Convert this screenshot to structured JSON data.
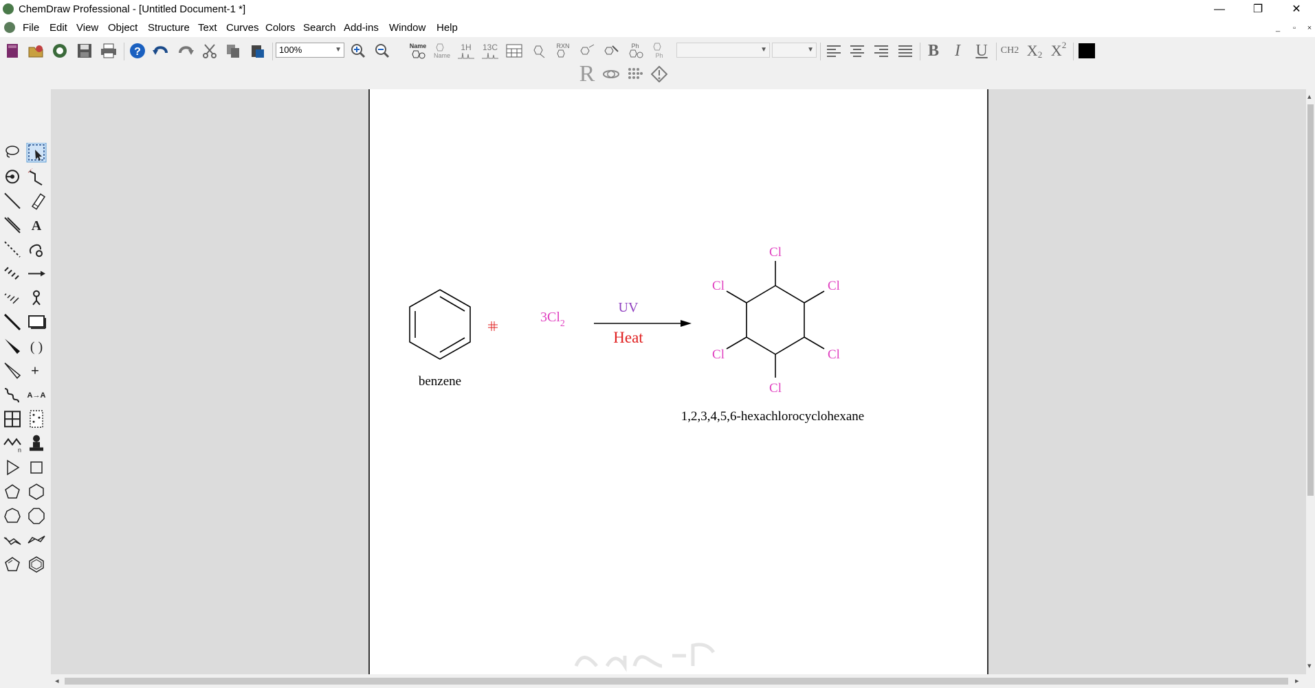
{
  "window": {
    "title": "ChemDraw Professional - [Untitled Document-1 *]",
    "app_icon": "chemdraw-icon",
    "controls": {
      "minimize": "—",
      "restore": "❐",
      "close": "✕"
    }
  },
  "menubar": {
    "items": [
      "File",
      "Edit",
      "View",
      "Object",
      "Structure",
      "Text",
      "Curves",
      "Colors",
      "Search",
      "Add-ins",
      "Window",
      "Help"
    ],
    "mdi_controls": {
      "minimize": "_",
      "restore": "▫",
      "close": "×"
    }
  },
  "toolbar": {
    "zoom": "100%",
    "name_label": "Name",
    "name_struct_label": "Name",
    "h1_label": "1H",
    "c13_label": "13C",
    "rxn_label": "RXN",
    "ph_label": "Ph",
    "r_label": "R",
    "font_value": "",
    "size_value": "",
    "bold_label": "B",
    "italic_label": "I",
    "underline_label": "U",
    "ch2_label": "CH2",
    "subscript_label": "X",
    "subscript_suffix": "2",
    "superscript_label": "X",
    "superscript_suffix": "2",
    "color_swatch": "#000000"
  },
  "tools": [
    "lasso-icon",
    "select-arrow-icon",
    "orbit-icon",
    "chain-icon",
    "single-bond-icon",
    "eraser-icon",
    "bold-bond-icon",
    "text-icon",
    "dashed-bond-icon",
    "pen-icon",
    "hashed-bond-icon",
    "arrow-icon",
    "hashed-wedge-icon",
    "atom-map-icon",
    "single-bond-icon-2",
    "rectangle-icon",
    "wedge-bond-icon",
    "brackets-icon",
    "hollow-wedge-icon",
    "charge-plus-icon",
    "wavy-bond-icon",
    "atom-label-icon",
    "table-icon",
    "tlc-icon",
    "acyclic-chain-icon",
    "stamp-icon",
    "triangle-icon",
    "square-icon",
    "pentagon-icon",
    "hexagon-icon",
    "heptagon-icon",
    "octagon-icon",
    "cyclohexane-chair1-icon",
    "cyclohexane-chair2-icon",
    "cyclopentane-icon",
    "benzene-icon"
  ],
  "drawing": {
    "reactant_label": "benzene",
    "reagent": "3Cl",
    "reagent_sub": "2",
    "arrow_above": "UV",
    "arrow_below": "Heat",
    "product_substituent": "Cl",
    "product_label": "1,2,3,4,5,6-hexachlorocyclohexane",
    "colors": {
      "chlorine": "#e040c0",
      "uv": "#9040c0",
      "heat": "#e02020",
      "plus": "#e02020"
    }
  }
}
